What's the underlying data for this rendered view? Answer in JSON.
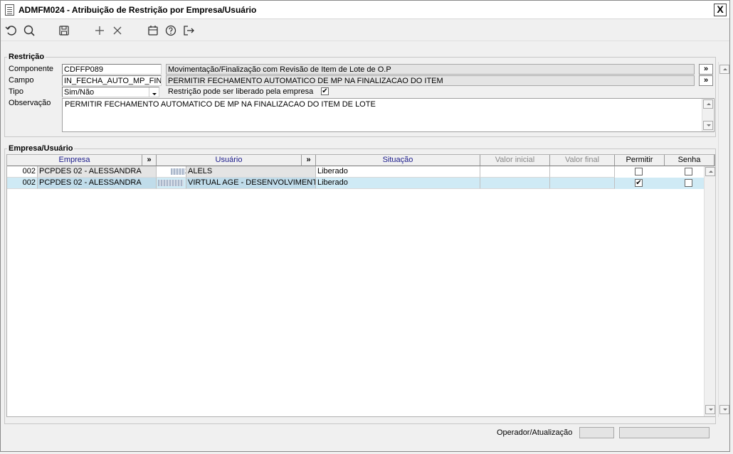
{
  "window": {
    "title": "ADMFM024 - Atribuição de Restrição por Empresa/Usuário",
    "close_label": "X"
  },
  "toolbar": {
    "buttons": [
      "undo-icon",
      "search-icon",
      "save-icon",
      "add-icon",
      "delete-icon",
      "calendar-icon",
      "help-icon",
      "exit-icon"
    ]
  },
  "restricao": {
    "legend": "Restrição",
    "componente_label": "Componente",
    "componente_value": "CDFFP089",
    "componente_desc": "Movimentação/Finalização com Revisão de Item de Lote de O.P",
    "campo_label": "Campo",
    "campo_value": "IN_FECHA_AUTO_MP_FIN",
    "campo_desc": "PERMITIR FECHAMENTO AUTOMATICO DE MP NA FINALIZACAO DO ITEM",
    "tipo_label": "Tipo",
    "tipo_value": "Sim/Não",
    "liberado_label": "Restrição pode ser liberado pela empresa",
    "liberado_checked": "✔",
    "observacao_label": "Observação",
    "observacao_value": "PERMITIR FECHAMENTO AUTOMATICO DE MP NA FINALIZACAO DO ITEM DE LOTE",
    "more_label": "»"
  },
  "empresa_usuario": {
    "legend": "Empresa/Usuário",
    "columns": {
      "empresa": "Empresa",
      "usuario": "Usuário",
      "situacao": "Situação",
      "valor_inicial": "Valor inicial",
      "valor_final": "Valor final",
      "permitir": "Permitir",
      "senha": "Senha",
      "more": "»"
    },
    "rows": [
      {
        "empresa_code": "002",
        "empresa_name": "PCPDES 02 - ALESSANDRA",
        "usuario_code": "2",
        "usuario_name": "ALELS",
        "situacao": "Liberado",
        "valor_inicial": "",
        "valor_final": "",
        "permitir": "",
        "senha": ""
      },
      {
        "empresa_code": "002",
        "empresa_name": "PCPDES 02 - ALESSANDRA",
        "usuario_code": "",
        "usuario_name": "VIRTUAL AGE - DESENVOLVIMENTO",
        "situacao": "Liberado",
        "valor_inicial": "",
        "valor_final": "",
        "permitir": "✔",
        "senha": ""
      }
    ]
  },
  "footer": {
    "operador_label": "Operador/Atualização",
    "operador_value": "",
    "atualizacao_value": ""
  },
  "colors": {
    "selected_row": "#cfeaf5",
    "header_text": "#1a1a8a",
    "readonly_bg": "#e4e4e4"
  }
}
